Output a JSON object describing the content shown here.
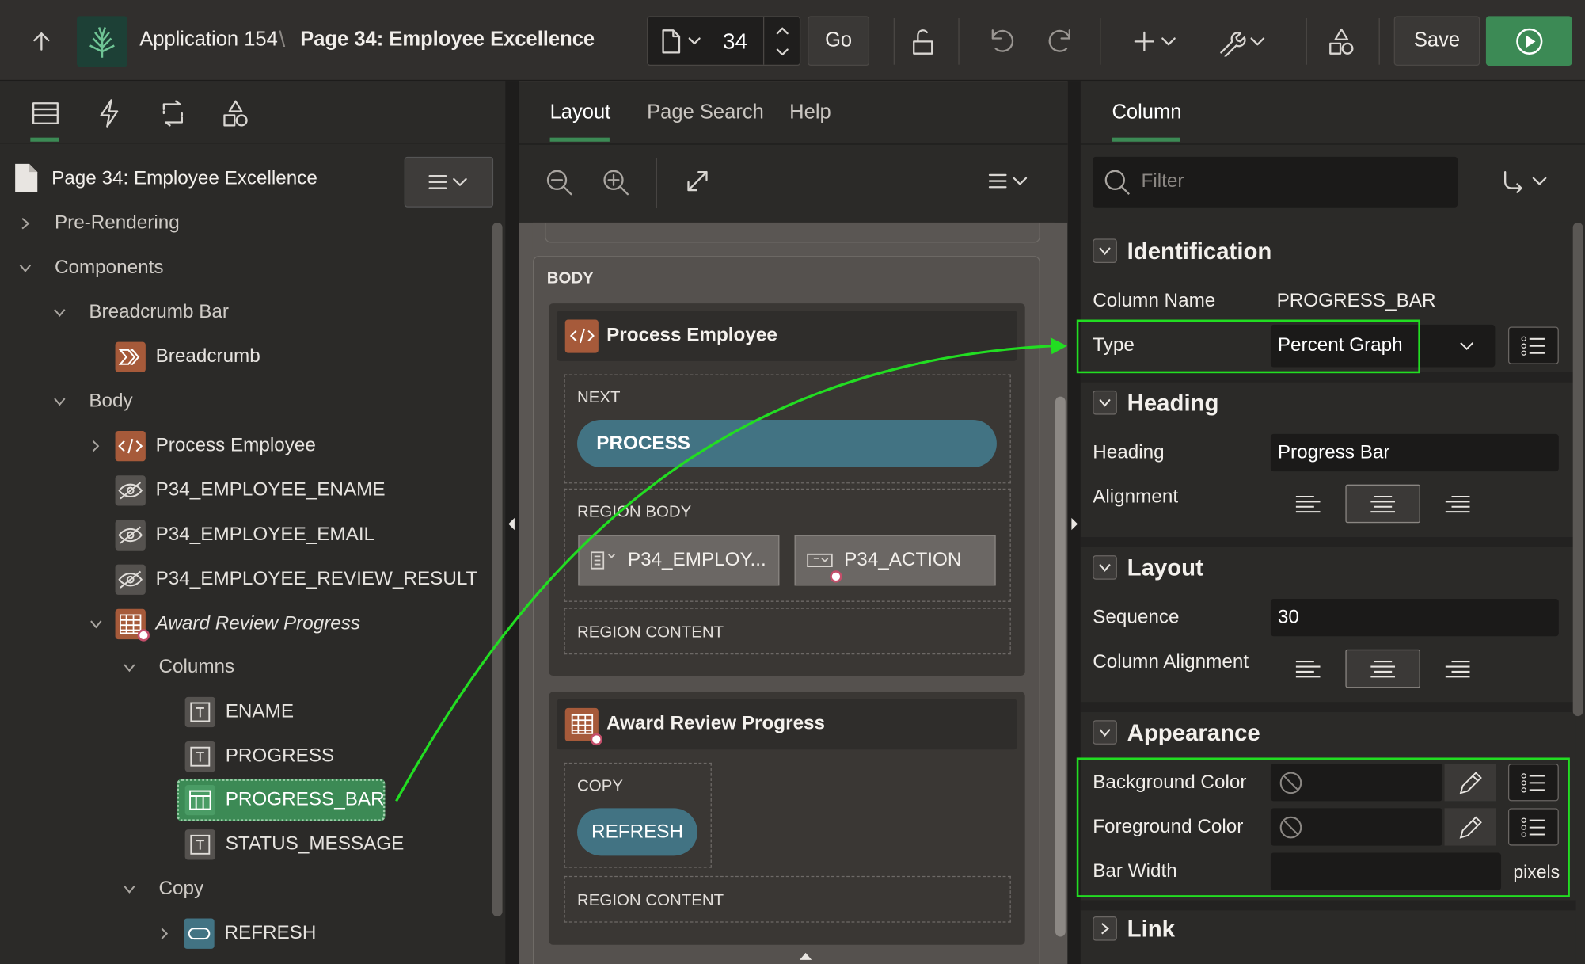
{
  "toolbar": {
    "app_name": "Application 154",
    "separator": "\\",
    "page_title": "Page 34: Employee Excellence",
    "page_number": "34",
    "go_label": "Go",
    "save_label": "Save"
  },
  "left_pane": {
    "root_title": "Page 34: Employee Excellence",
    "tree": {
      "pre_rendering": "Pre-Rendering",
      "components": "Components",
      "breadcrumb_bar": "Breadcrumb Bar",
      "breadcrumb": "Breadcrumb",
      "body": "Body",
      "process_employee": "Process Employee",
      "item_ename": "P34_EMPLOYEE_ENAME",
      "item_email": "P34_EMPLOYEE_EMAIL",
      "item_review": "P34_EMPLOYEE_REVIEW_RESULT",
      "award_review": "Award Review Progress",
      "columns": "Columns",
      "col_ename": "ENAME",
      "col_progress": "PROGRESS",
      "col_progress_bar": "PROGRESS_BAR",
      "col_status": "STATUS_MESSAGE",
      "copy": "Copy",
      "refresh": "REFRESH"
    }
  },
  "mid_pane": {
    "tabs": [
      "Layout",
      "Page Search",
      "Help"
    ],
    "body_label": "BODY",
    "process_region": {
      "title": "Process Employee",
      "next_label": "NEXT",
      "process_button": "PROCESS",
      "region_body": "REGION BODY",
      "item1": "P34_EMPLOY...",
      "item2": "P34_ACTION",
      "region_content": "REGION CONTENT"
    },
    "award_region": {
      "title": "Award Review Progress",
      "copy_label": "COPY",
      "refresh_button": "REFRESH",
      "region_content": "REGION CONTENT"
    }
  },
  "right_pane": {
    "tab": "Column",
    "filter_placeholder": "Filter",
    "identification": {
      "header": "Identification",
      "column_name_label": "Column Name",
      "column_name_value": "PROGRESS_BAR",
      "type_label": "Type",
      "type_value": "Percent Graph"
    },
    "heading": {
      "header": "Heading",
      "heading_label": "Heading",
      "heading_value": "Progress Bar",
      "alignment_label": "Alignment",
      "alignment_selected": "center"
    },
    "layout": {
      "header": "Layout",
      "sequence_label": "Sequence",
      "sequence_value": "30",
      "column_alignment_label": "Column Alignment",
      "column_alignment_selected": "center"
    },
    "appearance": {
      "header": "Appearance",
      "bg_color_label": "Background Color",
      "fg_color_label": "Foreground Color",
      "bar_width_label": "Bar Width",
      "bar_width_value": "",
      "bar_width_unit": "pixels"
    },
    "link": {
      "header": "Link"
    }
  },
  "colors": {
    "accent_green": "#3c8a55",
    "highlight_green": "#22dd22",
    "button_teal": "#427383",
    "component_orange": "#a65a3a"
  }
}
